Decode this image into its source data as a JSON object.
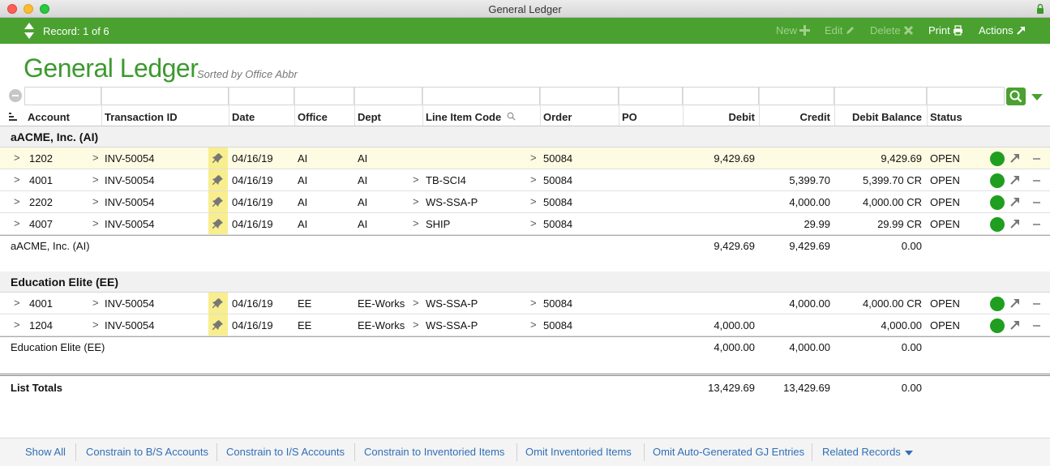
{
  "window": {
    "title": "General Ledger"
  },
  "toolbar": {
    "record_label": "Record: 1 of 6",
    "new_label": "New",
    "edit_label": "Edit",
    "delete_label": "Delete",
    "print_label": "Print",
    "actions_label": "Actions"
  },
  "header": {
    "title": "General Ledger",
    "sort_note": "Sorted by Office Abbr"
  },
  "columns": {
    "account": "Account",
    "transaction_id": "Transaction ID",
    "date": "Date",
    "office": "Office",
    "dept": "Dept",
    "line_item_code": "Line Item Code",
    "order": "Order",
    "po": "PO",
    "debit": "Debit",
    "credit": "Credit",
    "debit_balance": "Debit Balance",
    "status": "Status"
  },
  "groups": [
    {
      "name": "aACME, Inc.  (AI)",
      "rows": [
        {
          "account": "1202",
          "transaction_id": "INV-50054",
          "date": "04/16/19",
          "office": "AI",
          "dept": "AI",
          "line_item_code": "",
          "order": "50084",
          "debit": "9,429.69",
          "credit": "",
          "debit_balance": "9,429.69",
          "status": "OPEN"
        },
        {
          "account": "4001",
          "transaction_id": "INV-50054",
          "date": "04/16/19",
          "office": "AI",
          "dept": "AI",
          "line_item_code": "TB-SCI4",
          "order": "50084",
          "debit": "",
          "credit": "5,399.70",
          "debit_balance": "5,399.70 CR",
          "status": "OPEN"
        },
        {
          "account": "2202",
          "transaction_id": "INV-50054",
          "date": "04/16/19",
          "office": "AI",
          "dept": "AI",
          "line_item_code": "WS-SSA-P",
          "order": "50084",
          "debit": "",
          "credit": "4,000.00",
          "debit_balance": "4,000.00 CR",
          "status": "OPEN"
        },
        {
          "account": "4007",
          "transaction_id": "INV-50054",
          "date": "04/16/19",
          "office": "AI",
          "dept": "AI",
          "line_item_code": "SHIP",
          "order": "50084",
          "debit": "",
          "credit": "29.99",
          "debit_balance": "29.99 CR",
          "status": "OPEN"
        }
      ],
      "subtotal": {
        "label": "aACME, Inc.  (AI)",
        "debit": "9,429.69",
        "credit": "9,429.69",
        "debit_balance": "0.00"
      }
    },
    {
      "name": "Education Elite  (EE)",
      "rows": [
        {
          "account": "4001",
          "transaction_id": "INV-50054",
          "date": "04/16/19",
          "office": "EE",
          "dept": "EE-Works",
          "line_item_code": "WS-SSA-P",
          "order": "50084",
          "debit": "",
          "credit": "4,000.00",
          "debit_balance": "4,000.00 CR",
          "status": "OPEN"
        },
        {
          "account": "1204",
          "transaction_id": "INV-50054",
          "date": "04/16/19",
          "office": "EE",
          "dept": "EE-Works",
          "line_item_code": "WS-SSA-P",
          "order": "50084",
          "debit": "4,000.00",
          "credit": "",
          "debit_balance": "4,000.00",
          "status": "OPEN"
        }
      ],
      "subtotal": {
        "label": "Education Elite  (EE)",
        "debit": "4,000.00",
        "credit": "4,000.00",
        "debit_balance": "0.00"
      }
    }
  ],
  "totals": {
    "label": "List Totals",
    "debit": "13,429.69",
    "credit": "13,429.69",
    "debit_balance": "0.00"
  },
  "bottom_links": [
    "Show All",
    "Constrain to B/S Accounts",
    "Constrain to I/S Accounts",
    "Constrain to Inventoried Items",
    "Omit Inventoried Items",
    "Omit Auto-Generated GJ Entries",
    "Related Records"
  ],
  "colors": {
    "brand_green": "#4aa12f",
    "title_green": "#3c9a2e",
    "link_blue": "#2f6fb7",
    "status_green": "#1f9e1f",
    "pin_yellow": "#f8ee8e"
  },
  "icons": {
    "pin": "pushpin-icon",
    "open": "open-record-arrow-icon",
    "status": "status-dot-icon",
    "search": "search-icon"
  }
}
